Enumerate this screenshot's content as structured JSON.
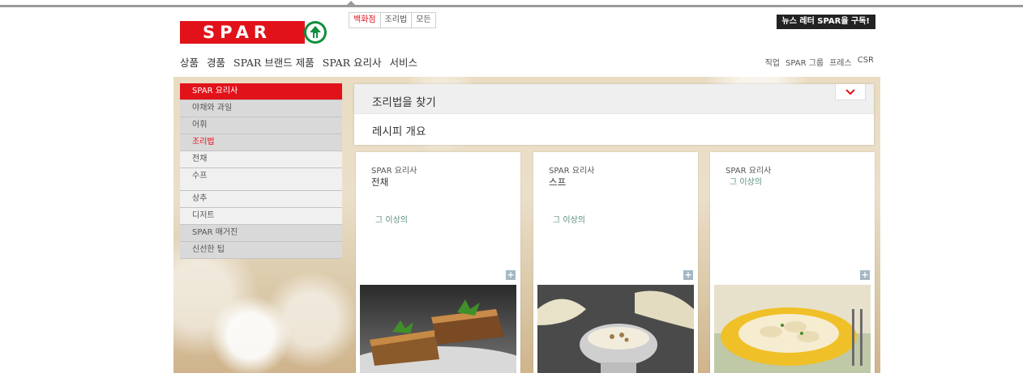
{
  "header": {
    "logo_text": "SPAR",
    "tabs": [
      {
        "label": "백화점",
        "active": true
      },
      {
        "label": "조리법",
        "active": false
      },
      {
        "label": "모든",
        "active": false
      }
    ],
    "newsletter_label": "뉴스 레터 SPAR을 구독!"
  },
  "main_nav": [
    "상품",
    "경품",
    "SPAR 브랜드 제품",
    "SPAR 요리사",
    "서비스"
  ],
  "sub_nav": [
    "직업",
    "SPAR 그룹",
    "프레스",
    "CSR"
  ],
  "sidebar": {
    "items": [
      {
        "label": "SPAR 요리사",
        "style": "head"
      },
      {
        "label": "야채와 과일",
        "style": "dark"
      },
      {
        "label": "어휘",
        "style": "dark"
      },
      {
        "label": "조리법",
        "style": "dark-red"
      },
      {
        "label": "전채",
        "style": "light"
      },
      {
        "label": "수프",
        "style": "light-tall"
      },
      {
        "label": "상추",
        "style": "light"
      },
      {
        "label": "디저트",
        "style": "light"
      },
      {
        "label": "SPAR 매거진",
        "style": "dark"
      },
      {
        "label": "신선한 팁",
        "style": "dark"
      }
    ]
  },
  "finder": {
    "title": "조리법을 찾기",
    "overview": "레시피 개요"
  },
  "cards": [
    {
      "kicker": "SPAR 요리사",
      "title": "전채",
      "more": "그 이상의",
      "image": "toast-with-herbs"
    },
    {
      "kicker": "SPAR 요리사",
      "title": "스프",
      "more": "그 이상의",
      "image": "cream-soup-bowl"
    },
    {
      "kicker": "SPAR 요리사",
      "title": "",
      "more": "그 이상의",
      "image": "rolled-pasta-plate"
    }
  ],
  "colors": {
    "brand_red": "#e2121b",
    "brand_green": "#0f8f3d",
    "link_green": "#5a8d7a"
  }
}
